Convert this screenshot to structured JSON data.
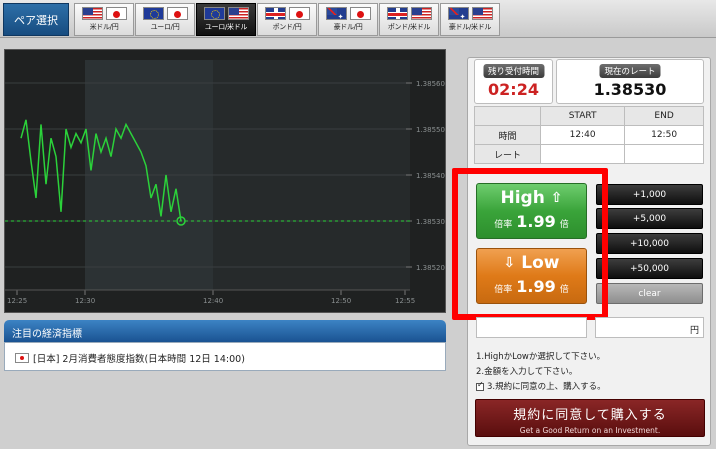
{
  "tabs": {
    "pair_select_label": "ペア選択",
    "items": [
      {
        "label": "米ドル/円",
        "flags": [
          "us-flag-icon",
          "jp-flag-icon"
        ],
        "active": false
      },
      {
        "label": "ユーロ/円",
        "flags": [
          "eu-flag-icon",
          "jp-flag-icon"
        ],
        "active": false
      },
      {
        "label": "ユーロ/米ドル",
        "flags": [
          "eu-flag-icon",
          "us-flag-icon"
        ],
        "active": true
      },
      {
        "label": "ポンド/円",
        "flags": [
          "uk-flag-icon",
          "jp-flag-icon"
        ],
        "active": false
      },
      {
        "label": "豪ドル/円",
        "flags": [
          "au-flag-icon",
          "jp-flag-icon"
        ],
        "active": false
      },
      {
        "label": "ポンド/米ドル",
        "flags": [
          "uk-flag-icon",
          "us-flag-icon"
        ],
        "active": false
      },
      {
        "label": "豪ドル/米ドル",
        "flags": [
          "au-flag-icon",
          "us-flag-icon"
        ],
        "active": false
      }
    ]
  },
  "chart": {
    "y_ticks": [
      "1.38560",
      "1.38550",
      "1.38540",
      "1.38530",
      "1.38520"
    ],
    "x_ticks": [
      "12:25",
      "12:30",
      "12:40",
      "12:50",
      "12:55"
    ],
    "current_rate": 1.3853,
    "series": [
      1.38548,
      1.38552,
      1.38543,
      1.38535,
      1.38551,
      1.38538,
      1.38548,
      1.38544,
      1.38532,
      1.3855,
      1.38546,
      1.38549,
      1.38547,
      1.3855,
      1.38541,
      1.38549,
      1.38545,
      1.38548,
      1.38544,
      1.3855,
      1.38548,
      1.38551,
      1.38549,
      1.38547,
      1.38545,
      1.38542,
      1.38535,
      1.38538,
      1.38531,
      1.3854,
      1.38532,
      1.38537,
      1.3853
    ]
  },
  "econ": {
    "header": "注目の経済指標",
    "item": "[日本]  2月消費者態度指数(日本時間 12日 14:00)"
  },
  "panel": {
    "remaining_caption": "残り受付時間",
    "remaining_time": "02:24",
    "current_rate_caption": "現在のレート",
    "current_rate": "1.38530",
    "table": {
      "col_start": "START",
      "col_end": "END",
      "row_time": "時間",
      "row_rate": "レート",
      "start_time": "12:40",
      "end_time": "12:50"
    },
    "high": {
      "label": "High",
      "rate_label": "倍率",
      "rate": "1.99",
      "unit": "倍"
    },
    "low": {
      "label": "Low",
      "rate_label": "倍率",
      "rate": "1.99",
      "unit": "倍"
    },
    "amounts": [
      "+1,000",
      "+5,000",
      "+10,000",
      "+50,000"
    ],
    "clear": "clear",
    "yen_unit": "円",
    "steps": [
      "1.HighかLowか選択して下さい。",
      "2.金額を入力して下さい。",
      "3.規約に同意の上、購入する。"
    ],
    "buy": {
      "label": "規約に同意して購入する",
      "slogan": "Get a Good Return on an Investment."
    }
  }
}
